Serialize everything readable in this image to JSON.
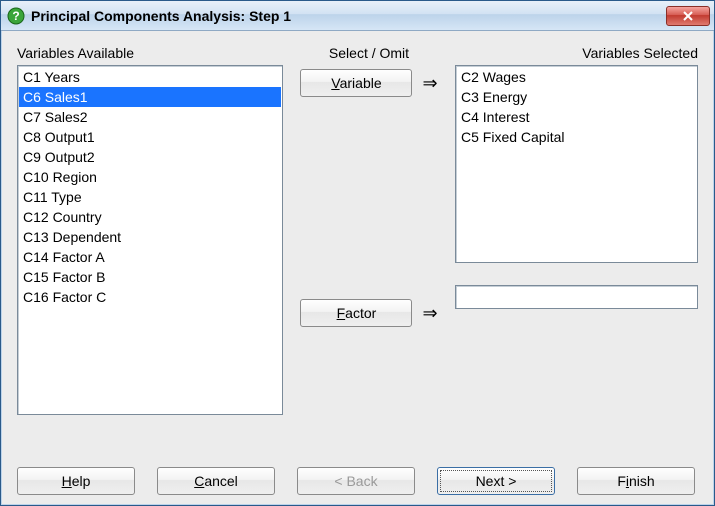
{
  "title": "Principal Components Analysis: Step 1",
  "labels": {
    "available": "Variables Available",
    "selectomit": "Select / Omit",
    "selected": "Variables Selected"
  },
  "available": [
    "C1 Years",
    "C6 Sales1",
    "C7 Sales2",
    "C8 Output1",
    "C9 Output2",
    "C10 Region",
    "C11 Type",
    "C12 Country",
    "C13 Dependent",
    "C14 Factor A",
    "C15 Factor B",
    "C16 Factor C"
  ],
  "available_selected_index": 1,
  "selected": [
    "C2 Wages",
    "C3 Energy",
    "C4 Interest",
    "C5 Fixed Capital"
  ],
  "buttons": {
    "variable": "Variable",
    "factor": "Factor",
    "help": "Help",
    "cancel": "Cancel",
    "back": "< Back",
    "next": "Next >",
    "finish": "Finish"
  },
  "factor_value": "",
  "arrow": "⇒"
}
